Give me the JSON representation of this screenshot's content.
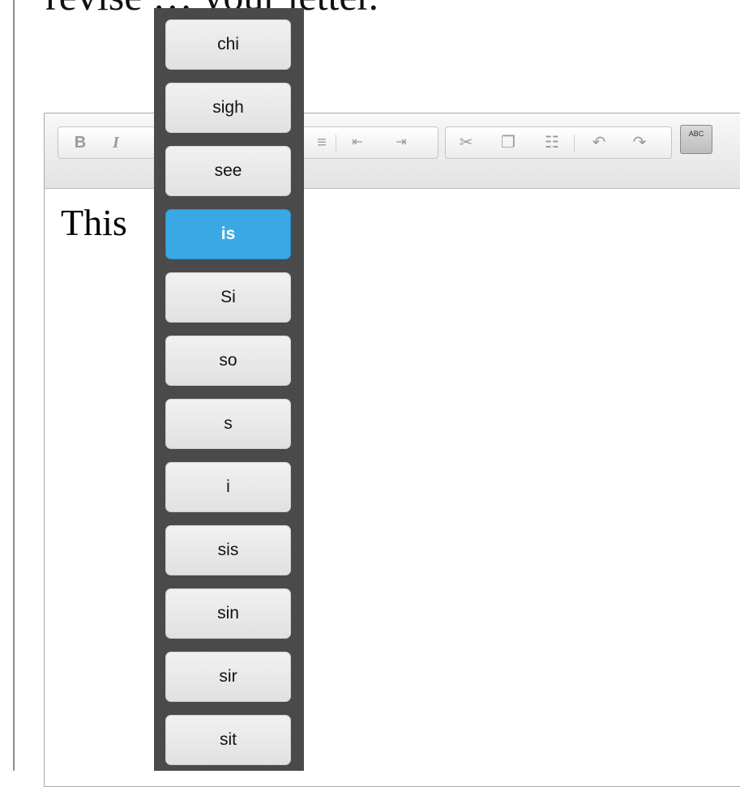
{
  "page": {
    "heading_text": "revise … your letter."
  },
  "editor": {
    "toolbar": {
      "bold_label": "B",
      "italic_label": "I",
      "spellcheck_label": "ABC"
    },
    "content_text": "This"
  },
  "suggestions": {
    "items": [
      "chi",
      "sigh",
      "see",
      "is",
      "Si",
      "so",
      "s",
      "i",
      "sis",
      "sin",
      "sir",
      "sit"
    ],
    "selected": "is"
  }
}
